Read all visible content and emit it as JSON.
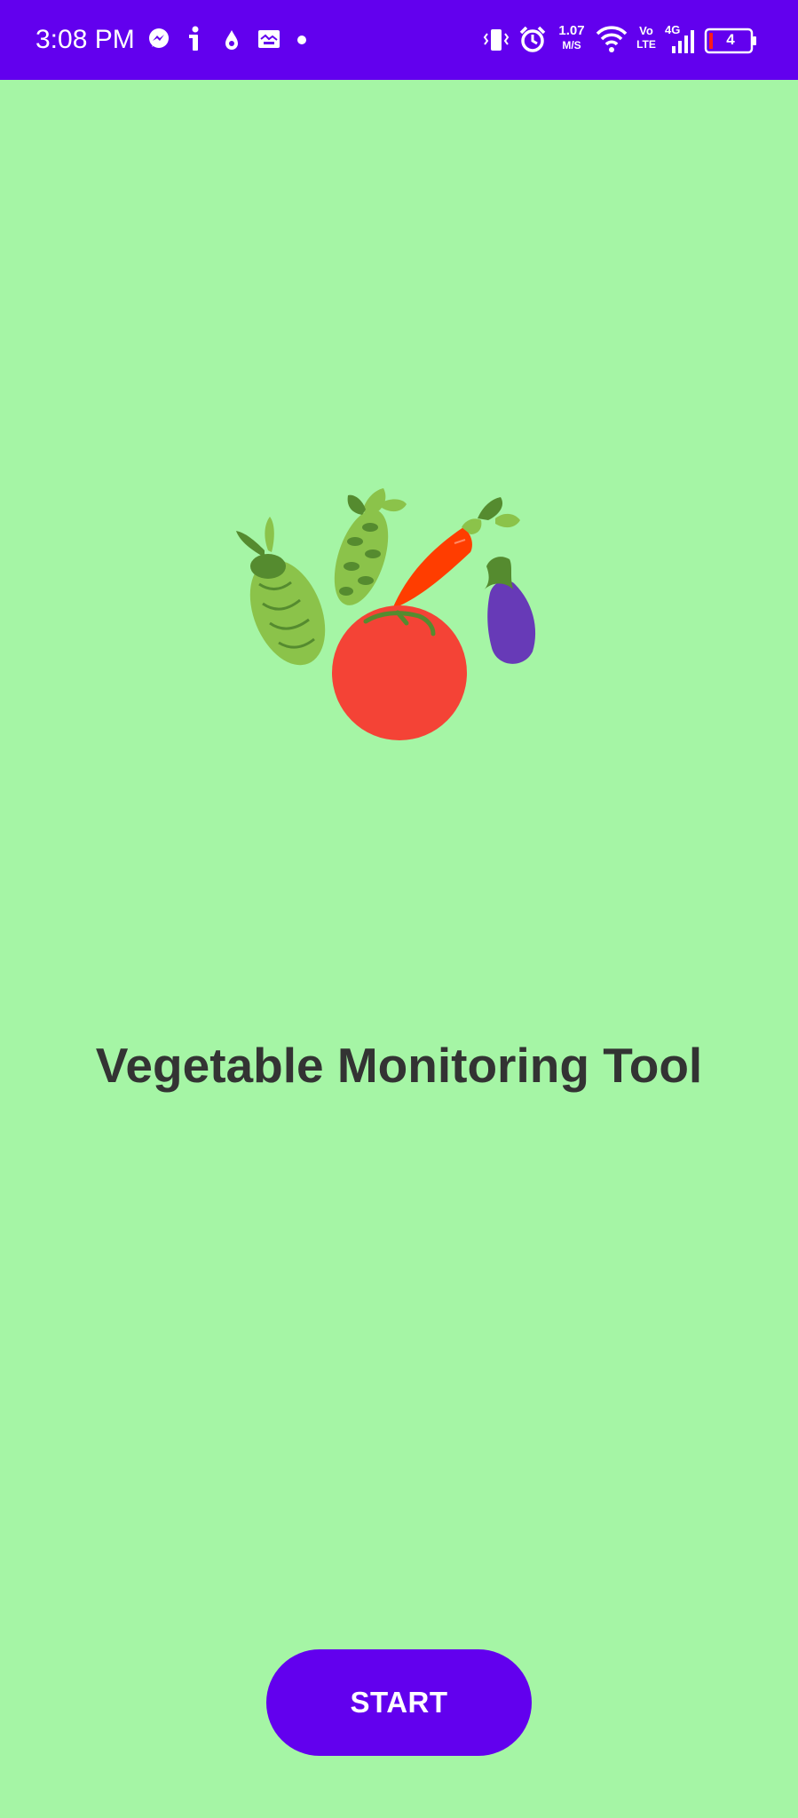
{
  "colors": {
    "status_bar": "#6200ee",
    "background": "#a5f5a5",
    "button": "#6200ee",
    "title_text": "#333333",
    "tomato": "#f44336",
    "carrot": "#ff3d00",
    "eggplant": "#673ab7",
    "leaf_dark": "#558b2f",
    "leaf_light": "#8bc34a"
  },
  "status_bar": {
    "time": "3:08 PM",
    "left_icons": [
      "messenger-icon",
      "info-icon",
      "droplet-icon",
      "image-icon",
      "dot-icon"
    ],
    "network_speed_value": "1.07",
    "network_speed_unit": "M/S",
    "volte_top": "Vo",
    "volte_bottom": "LTE",
    "network_type": "4G",
    "battery_level": "4",
    "right_icons": [
      "vibrate-icon",
      "alarm-icon",
      "wifi-icon",
      "signal-icon",
      "battery-icon"
    ]
  },
  "main": {
    "logo_icon": "vegetables-logo-icon",
    "title": "Vegetable Monitoring Tool",
    "start_button_label": "START"
  }
}
